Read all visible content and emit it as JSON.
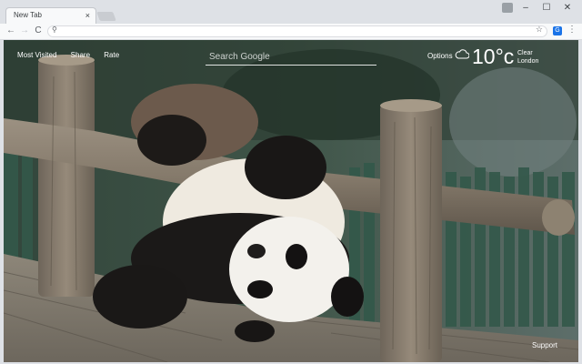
{
  "browser": {
    "tab_title": "New Tab",
    "tab_close": "×",
    "window_min": "–",
    "window_max": "☐",
    "window_close": "✕",
    "back": "←",
    "forward": "→",
    "reload": "C",
    "search_glyph": "⚲",
    "star_glyph": "☆",
    "ext_glyph": "G",
    "menu_glyph": "⋮"
  },
  "links": {
    "most_visited": "Most Visited",
    "share": "Share",
    "rate": "Rate"
  },
  "search": {
    "placeholder": "Search Google"
  },
  "options": "Options",
  "weather": {
    "temperature": "10°c",
    "condition": "Clear",
    "city": "London",
    "icon": "cloud-icon"
  },
  "support": "Support",
  "colors": {
    "chrome_bg": "#dee1e6",
    "toolbar_bg": "#f8f9fa",
    "accent": "#1a73e8"
  }
}
